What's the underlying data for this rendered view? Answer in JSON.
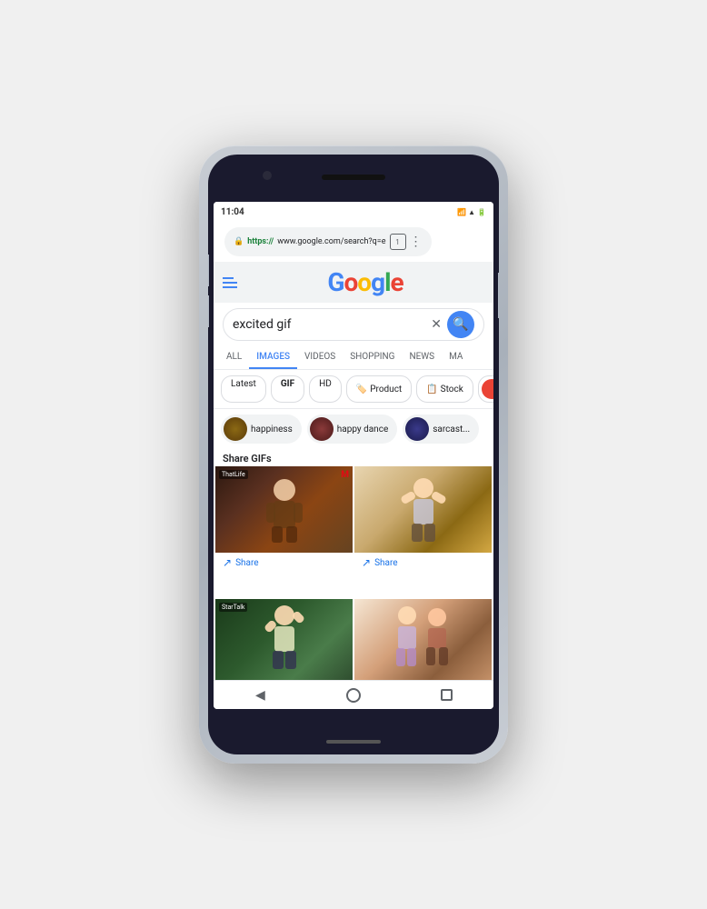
{
  "phone": {
    "status_bar": {
      "time": "11:04",
      "icons": "▣ 31 ⊙ ↓ •"
    },
    "url_bar": {
      "lock_icon": "🔒",
      "https_text": "https://",
      "url_text": "www.google.com/search?q=e",
      "tab_count": "1"
    },
    "header": {
      "logo_letters": [
        "G",
        "o",
        "o",
        "g",
        "l",
        "e"
      ]
    },
    "search": {
      "query": "excited gif",
      "placeholder": "Search"
    },
    "tabs": [
      {
        "label": "ALL",
        "active": false
      },
      {
        "label": "IMAGES",
        "active": true
      },
      {
        "label": "VIDEOS",
        "active": false
      },
      {
        "label": "SHOPPING",
        "active": false
      },
      {
        "label": "NEWS",
        "active": false
      },
      {
        "label": "MA",
        "active": false
      }
    ],
    "filter_chips": [
      {
        "label": "Latest"
      },
      {
        "label": "GIF"
      },
      {
        "label": "HD"
      },
      {
        "label": "Product",
        "has_tag": true
      },
      {
        "label": "Stock",
        "has_tag": true
      },
      {
        "label": "",
        "is_color": true
      }
    ],
    "related_searches": [
      {
        "label": "happiness"
      },
      {
        "label": "happy dance"
      },
      {
        "label": "sarcast..."
      }
    ],
    "section_label": "Share GIFs",
    "gif_items": [
      {
        "source": "ThatLife",
        "has_m": true,
        "position": "top-left"
      },
      {
        "source": "",
        "has_m": false,
        "position": "top-right"
      },
      {
        "source": "StarTalk",
        "has_m": false,
        "position": "bottom-left"
      },
      {
        "source": "",
        "has_m": false,
        "position": "bottom-right"
      }
    ],
    "share_label": "Share",
    "nav_buttons": {
      "back": "◀",
      "home": "",
      "recent": ""
    }
  }
}
